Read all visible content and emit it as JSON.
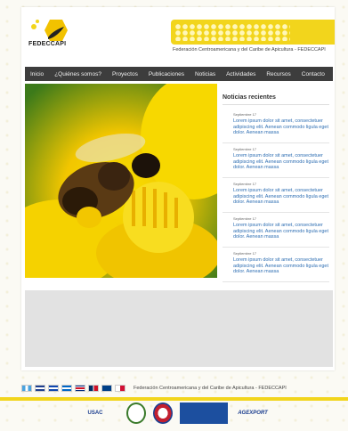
{
  "brand": {
    "name": "FEDECCAPI",
    "tagline": "Federación Centroamericana y del Caribe de Apicultura - FEDECCAPI"
  },
  "nav": [
    {
      "label": "Inicio"
    },
    {
      "label": "¿Quiénes somos?"
    },
    {
      "label": "Proyectos"
    },
    {
      "label": "Publicaciones"
    },
    {
      "label": "Noticias"
    },
    {
      "label": "Actividades"
    },
    {
      "label": "Recursos"
    },
    {
      "label": "Contacto"
    }
  ],
  "sidebar": {
    "title": "Noticias recientes",
    "posts": [
      {
        "date": "Septiembre 17",
        "text": "Lorem ipsum dolor sit amet, consectetuer adipiscing elit. Aenean commodo ligula eget dolor. Aenean massa"
      },
      {
        "date": "Septiembre 17",
        "text": "Lorem ipsum dolor sit amet, consectetuer adipiscing elit. Aenean commodo ligula eget dolor. Aenean massa"
      },
      {
        "date": "Septiembre 17",
        "text": "Lorem ipsum dolor sit amet, consectetuer adipiscing elit. Aenean commodo ligula eget dolor. Aenean massa"
      },
      {
        "date": "Septiembre 17",
        "text": "Lorem ipsum dolor sit amet, consectetuer adipiscing elit. Aenean commodo ligula eget dolor. Aenean massa"
      },
      {
        "date": "Septiembre 17",
        "text": "Lorem ipsum dolor sit amet, consectetuer adipiscing elit. Aenean commodo ligula eget dolor. Aenean massa"
      }
    ]
  },
  "footer": {
    "title": "Federación Centroamericana y del Caribe de Apicultura - FEDECCAPI",
    "sponsors": [
      {
        "label": "USAC"
      },
      {
        "label": ""
      },
      {
        "label": ""
      },
      {
        "label": ""
      },
      {
        "label": "AGEXPORT"
      }
    ]
  },
  "colors": {
    "accent": "#f2d51c",
    "nav_bg": "#3d3d3d",
    "link": "#2f6fb3"
  }
}
